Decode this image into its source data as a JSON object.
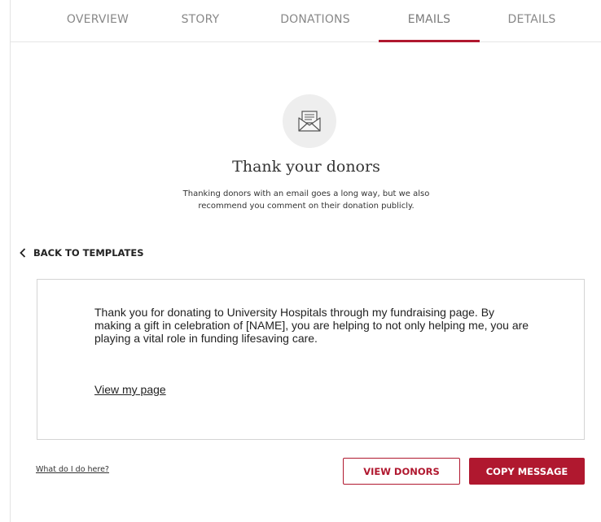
{
  "tabs": [
    {
      "label": "OVERVIEW"
    },
    {
      "label": "STORY"
    },
    {
      "label": "DONATIONS"
    },
    {
      "label": "EMAILS",
      "active": true
    },
    {
      "label": "DETAILS"
    }
  ],
  "hero": {
    "icon": "envelope-letter-icon",
    "title": "Thank your donors",
    "description_line1": "Thanking donors with an email goes a long way, but we also",
    "description_line2": "recommend you comment on their donation publicly."
  },
  "back_link": {
    "label": "BACK TO TEMPLATES",
    "icon": "chevron-left-icon"
  },
  "message": {
    "body": "Thank you for donating to University Hospitals through my fundraising page. By making a gift in celebration of [NAME], you are helping to not only helping me, you are playing a vital role in funding lifesaving care.",
    "link_text": "View my page"
  },
  "footer": {
    "help_link": "What do I do here?",
    "view_donors_label": "VIEW DONORS",
    "copy_message_label": "COPY MESSAGE"
  },
  "colors": {
    "accent": "#b0182f",
    "icon_circle": "#eeeeee",
    "border": "#d4d4d4"
  }
}
